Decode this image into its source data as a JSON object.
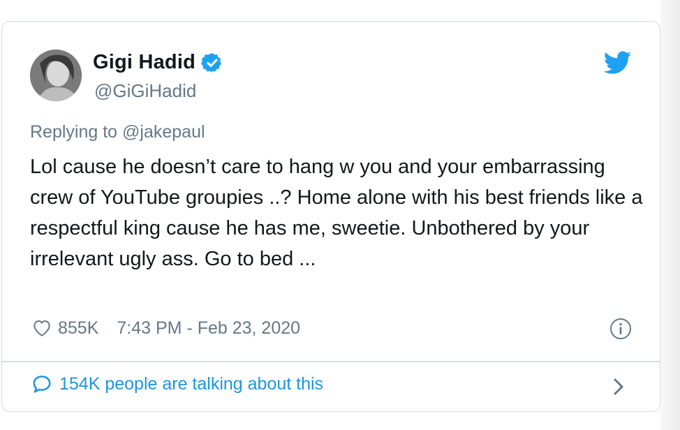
{
  "tweet": {
    "display_name": "Gigi Hadid",
    "handle": "@GiGiHadid",
    "replying_prefix": "Replying to ",
    "replying_to": "@jakepaul",
    "text": "Lol cause he doesn’t care to hang w you and your embarrassing crew of YouTube groupies ..? Home alone with his best friends like a respectful king cause he has me, sweetie. Unbothered by your irrelevant ugly ass. Go to bed ...",
    "likes": "855K",
    "timestamp": "7:43 PM - Feb 23, 2020",
    "talking_about": "154K people are talking about this"
  },
  "icons": {
    "verified": "verified-badge-icon",
    "logo": "twitter-bird-icon",
    "like": "heart-icon",
    "info": "info-icon",
    "conversation": "speech-bubble-icon",
    "more": "chevron-right-icon"
  },
  "colors": {
    "brand_blue": "#1da1f2",
    "link_blue": "#1b95e0",
    "text_primary": "#14171a",
    "text_secondary": "#657786",
    "border": "#d6dbe0"
  }
}
